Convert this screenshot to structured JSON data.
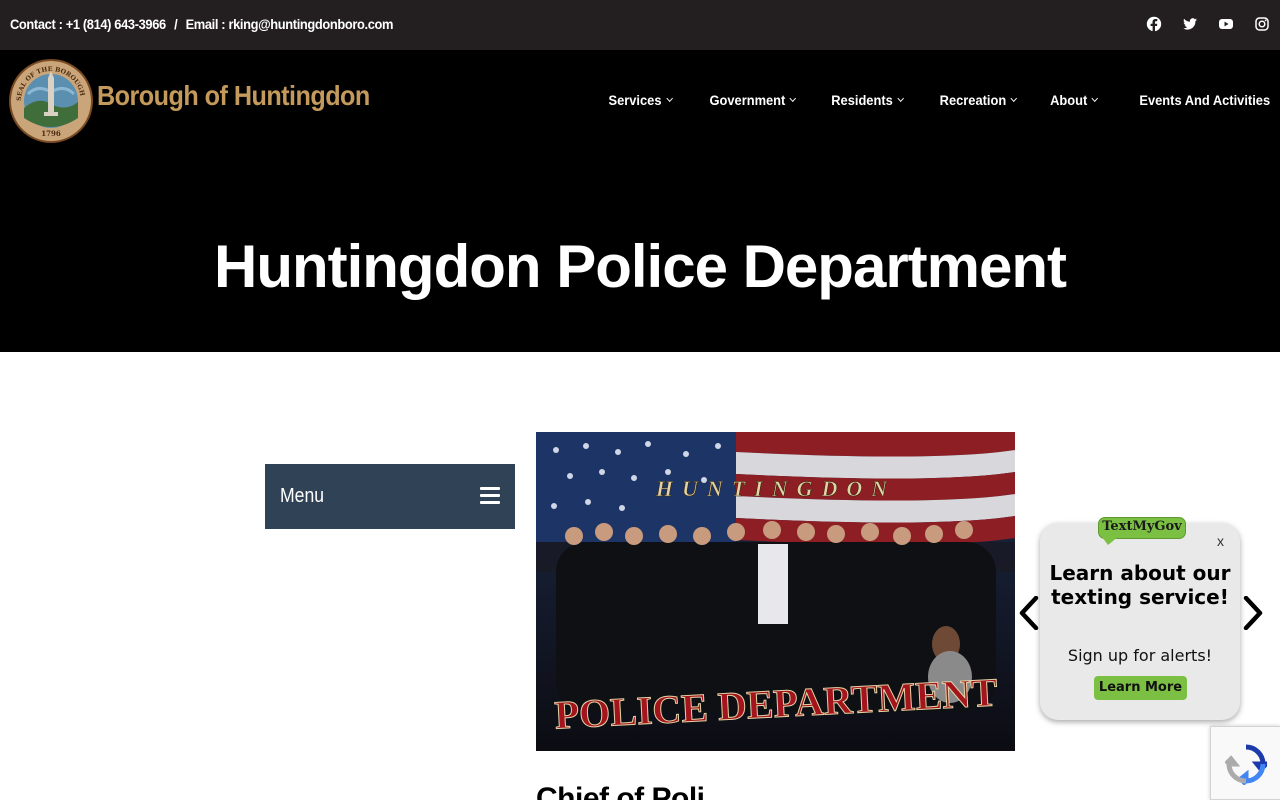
{
  "topbar": {
    "contact_label": "Contact : +1 (814) 643-3966",
    "separator": "/",
    "email_label": "Email : rking@huntingdonboro.com",
    "social_icons": [
      "facebook-icon",
      "twitter-icon",
      "youtube-icon",
      "instagram-icon"
    ]
  },
  "header": {
    "brand_name": "Borough of Huntingdon",
    "seal_text": [
      "SEAL OF THE BOROUGH OF HUNTINGDON",
      "1796"
    ],
    "brand_color": "#c49a5c",
    "nav": [
      {
        "label": "Services",
        "has_dropdown": true
      },
      {
        "label": "Government",
        "has_dropdown": true
      },
      {
        "label": "Residents",
        "has_dropdown": true
      },
      {
        "label": "Recreation",
        "has_dropdown": true
      },
      {
        "label": "About",
        "has_dropdown": true
      },
      {
        "label": "Events And Activities",
        "has_dropdown": false
      }
    ]
  },
  "hero": {
    "title": "Huntingdon Police Department"
  },
  "sidebar": {
    "menu_label": "Menu",
    "menu_bg": "#2f4256"
  },
  "main": {
    "photo_banner_top": "HUNTINGDON",
    "photo_banner_bottom": "POLICE DEPARTMENT",
    "section_heading": "Chief of Poli"
  },
  "textmygov": {
    "logo": "TextMyGov",
    "close": "x",
    "title": "Learn about our texting service!",
    "subtitle": "Sign up for alerts!",
    "button": "Learn More",
    "accent": "#7bc043"
  }
}
